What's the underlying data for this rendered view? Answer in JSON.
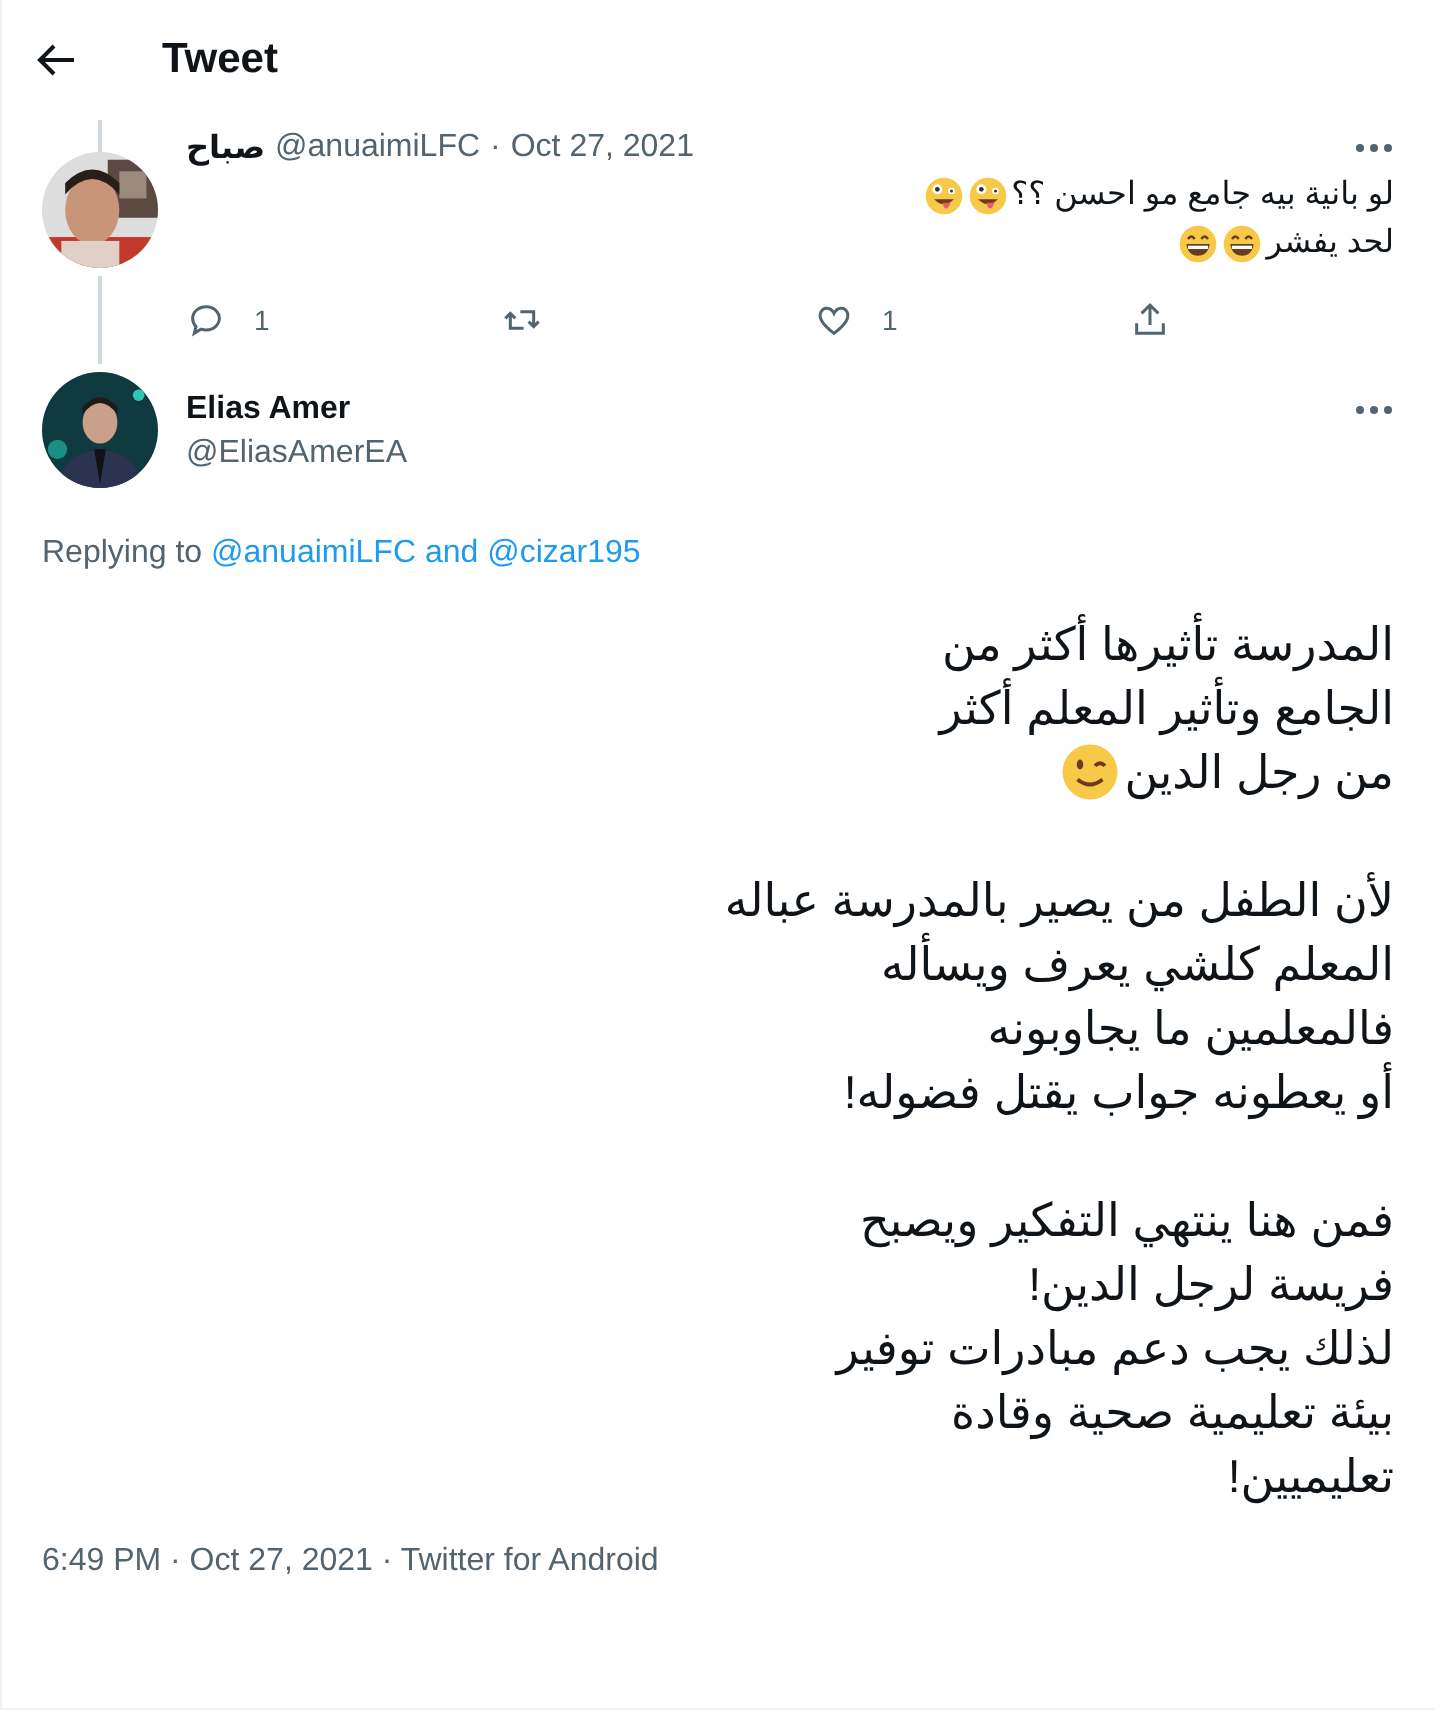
{
  "header": {
    "title": "Tweet"
  },
  "parent_tweet": {
    "name": "صباح",
    "handle": "@anuaimiLFC",
    "separator": "·",
    "date": "Oct 27, 2021",
    "lines": [
      {
        "text": "لو بانية بيه جامع مو احسن ؟؟",
        "emoji": [
          {
            "kind": "zany"
          },
          {
            "kind": "zany"
          }
        ]
      },
      {
        "text": "لحد يفشر",
        "emoji": [
          {
            "kind": "grin"
          },
          {
            "kind": "grin"
          }
        ]
      }
    ],
    "reply_count": "1",
    "like_count": "1"
  },
  "tweet": {
    "name": "Elias Amer",
    "handle": "@EliasAmerEA",
    "replying_label": "Replying to",
    "replying_to": "@anuaimiLFC and @cizar195",
    "paragraphs": [
      {
        "lines": [
          {
            "text": "المدرسة تأثيرها أكثر من"
          },
          {
            "text": "الجامع وتأثير المعلم أكثر"
          },
          {
            "text": "من رجل الدين",
            "emoji": [
              {
                "kind": "wink"
              }
            ]
          }
        ]
      },
      {
        "lines": [
          {
            "text": "لأن الطفل من يصير بالمدرسة عباله"
          },
          {
            "text": "المعلم كلشي يعرف ويسأله"
          },
          {
            "text": "فالمعلمين ما يجاوبونه"
          },
          {
            "text": "أو يعطونه جواب يقتل فضوله!"
          }
        ]
      },
      {
        "lines": [
          {
            "text": "فمن هنا ينتهي التفكير ويصبح"
          },
          {
            "text": "فريسة لرجل الدين!"
          },
          {
            "text": "لذلك يجب دعم مبادرات توفير"
          },
          {
            "text": "بيئة تعليمية صحية وقادة"
          },
          {
            "text": "تعليميين!"
          }
        ]
      }
    ],
    "meta": "6:49 PM · Oct 27, 2021 · Twitter for Android"
  }
}
